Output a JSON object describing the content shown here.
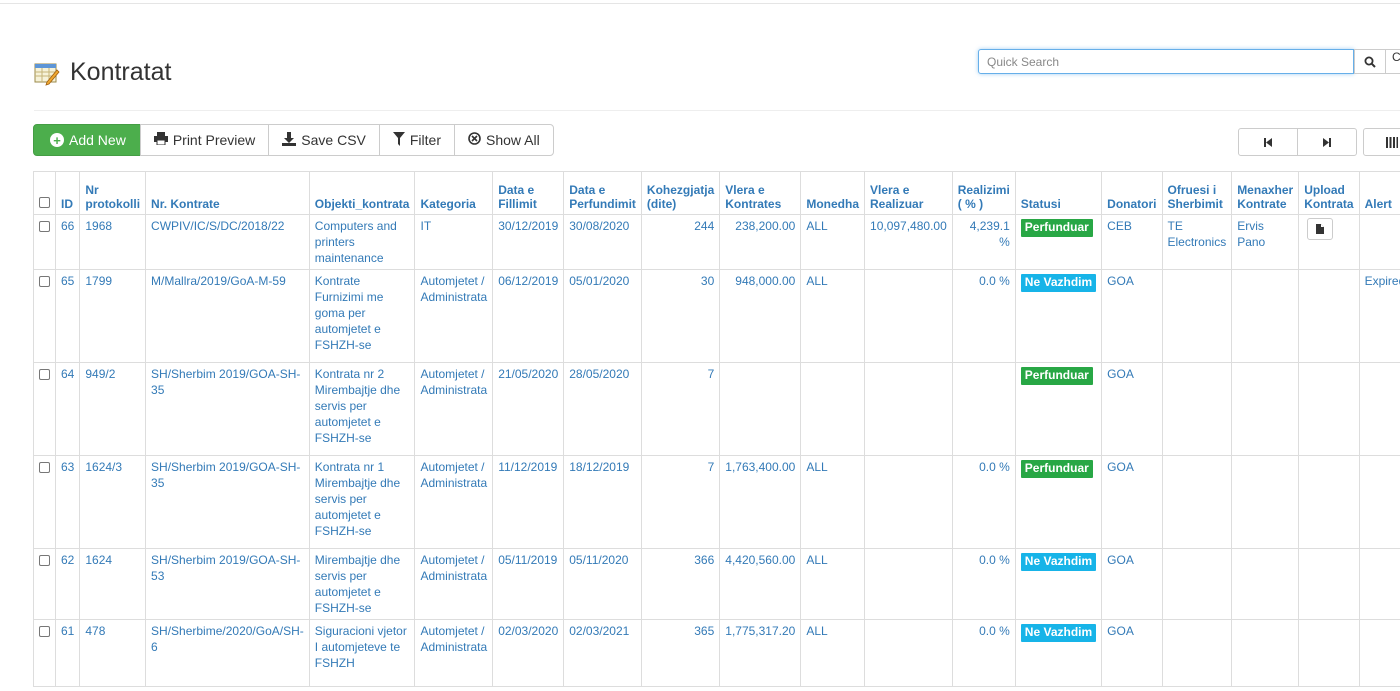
{
  "page": {
    "title": "Kontratat",
    "title_icon": "table-edit-icon"
  },
  "search": {
    "placeholder": "Quick Search",
    "button_icon": "search-icon",
    "button2_label": "C"
  },
  "toolbar": {
    "add_new": "Add New",
    "print_preview": "Print Preview",
    "save_csv": "Save CSV",
    "filter": "Filter",
    "show_all": "Show All"
  },
  "pager": {
    "first_icon": "first-page-icon",
    "last_icon": "last-page-icon",
    "columns_icon": "columns-icon"
  },
  "colors": {
    "link": "#337ab7",
    "done": "#28a745",
    "in_progress": "#17b4e8",
    "add_new": "#4cae4c"
  },
  "table": {
    "headers": {
      "id": "ID",
      "nr_protokolli": "Nr protokolli",
      "nr_kontrate": "Nr. Kontrate",
      "objekti": "Objekti_kontrata",
      "kategoria": "Kategoria",
      "data_fillimit": "Data e Fillimit",
      "data_perfundimit": "Data e Perfundimit",
      "kohezgjatja": "Kohezgjatja (dite)",
      "vlera_kontrates": "Vlera e Kontrates",
      "monedha": "Monedha",
      "vlera_realizuar": "Vlera e Realizuar",
      "realizimi": "Realizimi ( % )",
      "statusi": "Statusi",
      "donatori": "Donatori",
      "ofruesi": "Ofruesi i Sherbimit",
      "menaxher": "Menaxher Kontrate",
      "upload": "Upload Kontrata",
      "alert": "Alert"
    },
    "rows": [
      {
        "id": "66",
        "nr_protokolli": "1968",
        "nr_kontrate": "CWPIV/IC/S/DC/2018/22",
        "objekti": "Computers and printers maintenance",
        "kategoria": "IT",
        "data_fillimit": "30/12/2019",
        "data_perfundimit": "30/08/2020",
        "kohezgjatja": "244",
        "vlera_kontrates": "238,200.00",
        "monedha": "ALL",
        "vlera_realizuar": "10,097,480.00",
        "realizimi": "4,239.1 %",
        "statusi": "Perfunduar",
        "donatori": "CEB",
        "ofruesi": "TE Electronics",
        "menaxher": "Ervis Pano",
        "alert": ""
      },
      {
        "id": "65",
        "nr_protokolli": "1799",
        "nr_kontrate": "M/Mallra/2019/GoA-M-59",
        "objekti": "Kontrate Furnizimi me goma per automjetet e FSHZH-se",
        "kategoria": "Automjetet / Administrata",
        "data_fillimit": "06/12/2019",
        "data_perfundimit": "05/01/2020",
        "kohezgjatja": "30",
        "vlera_kontrates": "948,000.00",
        "monedha": "ALL",
        "vlera_realizuar": "",
        "realizimi": "0.0 %",
        "statusi": "Ne Vazhdim",
        "donatori": "GOA",
        "ofruesi": "",
        "menaxher": "",
        "alert": "Expired"
      },
      {
        "id": "64",
        "nr_protokolli": "949/2",
        "nr_kontrate": "SH/Sherbim 2019/GOA-SH-35",
        "objekti": "Kontrata nr 2 Mirembajtje dhe servis per automjetet e FSHZH-se",
        "kategoria": "Automjetet / Administrata",
        "data_fillimit": "21/05/2020",
        "data_perfundimit": "28/05/2020",
        "kohezgjatja": "7",
        "vlera_kontrates": "",
        "monedha": "",
        "vlera_realizuar": "",
        "realizimi": "",
        "statusi": "Perfunduar",
        "donatori": "GOA",
        "ofruesi": "",
        "menaxher": "",
        "alert": ""
      },
      {
        "id": "63",
        "nr_protokolli": "1624/3",
        "nr_kontrate": "SH/Sherbim 2019/GOA-SH-35",
        "objekti": "Kontrata nr 1 Mirembajtje dhe servis per automjetet e FSHZH-se",
        "kategoria": "Automjetet / Administrata",
        "data_fillimit": "11/12/2019",
        "data_perfundimit": "18/12/2019",
        "kohezgjatja": "7",
        "vlera_kontrates": "1,763,400.00",
        "monedha": "ALL",
        "vlera_realizuar": "",
        "realizimi": "0.0 %",
        "statusi": "Perfunduar",
        "donatori": "GOA",
        "ofruesi": "",
        "menaxher": "",
        "alert": ""
      },
      {
        "id": "62",
        "nr_protokolli": "1624",
        "nr_kontrate": "SH/Sherbim 2019/GOA-SH-53",
        "objekti": "Mirembajtje dhe servis per automjetet e FSHZH-se",
        "kategoria": "Automjetet / Administrata",
        "data_fillimit": "05/11/2019",
        "data_perfundimit": "05/11/2020",
        "kohezgjatja": "366",
        "vlera_kontrates": "4,420,560.00",
        "monedha": "ALL",
        "vlera_realizuar": "",
        "realizimi": "0.0 %",
        "statusi": "Ne Vazhdim",
        "donatori": "GOA",
        "ofruesi": "",
        "menaxher": "",
        "alert": ""
      },
      {
        "id": "61",
        "nr_protokolli": "478",
        "nr_kontrate": "SH/Sherbime/2020/GoA/SH-6",
        "objekti": "Siguracioni vjetor I automjeteve te FSHZH",
        "kategoria": "Automjetet / Administrata",
        "data_fillimit": "02/03/2020",
        "data_perfundimit": "02/03/2021",
        "kohezgjatja": "365",
        "vlera_kontrates": "1,775,317.20",
        "monedha": "ALL",
        "vlera_realizuar": "",
        "realizimi": "0.0 %",
        "statusi": "Ne Vazhdim",
        "donatori": "GOA",
        "ofruesi": "",
        "menaxher": "",
        "alert": ""
      }
    ]
  }
}
